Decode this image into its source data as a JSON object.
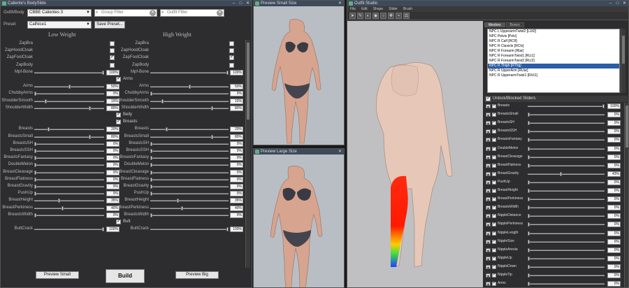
{
  "bodyslide": {
    "title": "Caliente's BodySlide",
    "outfit_label": "Outfit/Body",
    "outfit_value": "CBBE Calientes 3",
    "preset_label": "Preset",
    "preset_value": "CalNice1",
    "group_filter_placeholder": "Group Filter",
    "outfit_filter_placeholder": "Outfit Filter",
    "save_preset_label": "Save Preset...",
    "low_weight_label": "Low Weight",
    "high_weight_label": "High Weight",
    "top_rows": [
      {
        "label": "ZapBra",
        "checked": false
      },
      {
        "label": "ZapHoodCloak",
        "checked": false
      },
      {
        "label": "ZapFoolCloak",
        "checked": true
      },
      {
        "label": "ZapBody",
        "checked": false
      }
    ],
    "top_slider": {
      "label": "Mpf-Bone",
      "low": 100,
      "high": 100,
      "low_text": "100%",
      "high_text": "100%"
    },
    "arms_section": "Arms",
    "arms_rows": [
      {
        "label": "Arms",
        "low": 50,
        "high": 50,
        "low_text": "50%",
        "high_text": "50%"
      },
      {
        "label": "ChubbyArms",
        "low": 0,
        "high": 0,
        "low_text": "0%",
        "high_text": "0%"
      },
      {
        "label": "ShoulderSmooth",
        "low": 15,
        "high": 15,
        "low_text": "15%",
        "high_text": "15%"
      },
      {
        "label": "ShoulderWidth",
        "low": 80,
        "high": 80,
        "low_text": "80%",
        "high_text": "80%"
      }
    ],
    "belly_section": "Belly",
    "breasts_section": "Breasts",
    "breast_rows": [
      {
        "label": "Breasts",
        "low": 20,
        "high": 20,
        "low_text": "20%",
        "high_text": "20%"
      },
      {
        "label": "BreastsSmall",
        "low": 80,
        "high": 80,
        "low_text": "80%",
        "high_text": "80%"
      },
      {
        "label": "BreastsSH",
        "low": 0,
        "high": 0,
        "low_text": "0%",
        "high_text": "0%"
      },
      {
        "label": "BreastsSSH",
        "low": 0,
        "high": 0,
        "low_text": "0%",
        "high_text": "0%"
      },
      {
        "label": "BreastsFantasy",
        "low": 0,
        "high": 0,
        "low_text": "0%",
        "high_text": "0%"
      },
      {
        "label": "DoubleMelon",
        "low": 0,
        "high": 0,
        "low_text": "0%",
        "high_text": "0%"
      },
      {
        "label": "BreastCleavage",
        "low": 0,
        "high": 0,
        "low_text": "0%",
        "high_text": "0%"
      },
      {
        "label": "BreastFlatness",
        "low": 0,
        "high": 0,
        "low_text": "0%",
        "high_text": "0%"
      },
      {
        "label": "BreastGravity",
        "low": 0,
        "high": 0,
        "low_text": "0%",
        "high_text": "0%"
      },
      {
        "label": "PushUp",
        "low": 0,
        "high": 0,
        "low_text": "0%",
        "high_text": "0%"
      },
      {
        "label": "BreastHeight",
        "low": 35,
        "high": 35,
        "low_text": "35%",
        "high_text": "35%"
      },
      {
        "label": "BreastPerkiness",
        "low": 40,
        "high": 40,
        "low_text": "40%",
        "high_text": "40%"
      },
      {
        "label": "BreastsWidth",
        "low": 0,
        "high": 0,
        "low_text": "0%",
        "high_text": "0%"
      }
    ],
    "butt_section": "Butt",
    "butt_row": {
      "label": "ButtCrack",
      "low": 100,
      "high": 100,
      "low_text": "100%",
      "high_text": "100%"
    },
    "preview_small_label": "Preview Small",
    "build_label": "Build",
    "preview_big_label": "Preview Big"
  },
  "preview_small": {
    "title": "Preview Small Size"
  },
  "preview_large": {
    "title": "Preview Large Size"
  },
  "outfit_studio": {
    "title": "Outfit Studio",
    "menu": [
      "File",
      "Edit",
      "Shape",
      "Slider",
      "Brush"
    ],
    "tabs": [
      "Meshes",
      "Bones"
    ],
    "bone_list": [
      "NPC L UpperarmTwist2 [LUt2]",
      "NPC Pelvis [Pelv]",
      "NPC R Calf [RClf]",
      "NPC R Clavicle [RClv]",
      "NPC R Forearm [Rlar]",
      "NPC R ForearmTwist1 [RLt1]",
      "NPC R ForearmTwist2 [RLt2]",
      "NPC R Thigh [RThg]",
      "NPC R UpperArm [RUar]",
      "NPC R UpperarmTwist1 [RUt1]"
    ],
    "selected_bone_index": 7,
    "sliders_header": "Unlock/Blocked Sliders",
    "sliders": [
      {
        "name": "Breasts",
        "value": 100,
        "text": "100%"
      },
      {
        "name": "BreastsSmall",
        "value": 0,
        "text": "0%"
      },
      {
        "name": "BreastsSH",
        "value": 0,
        "text": "0%"
      },
      {
        "name": "BreastsSSH",
        "value": 0,
        "text": "0%"
      },
      {
        "name": "BreastsFantasy",
        "value": 0,
        "text": "0%"
      },
      {
        "name": "DoubleMelon",
        "value": 0,
        "text": "0%"
      },
      {
        "name": "BreastCleavage",
        "value": 0,
        "text": "0%"
      },
      {
        "name": "BreastFlatness",
        "value": 0,
        "text": "0%"
      },
      {
        "name": "BreastGravity",
        "value": 43,
        "text": "43%"
      },
      {
        "name": "PushUp",
        "value": 0,
        "text": "0%"
      },
      {
        "name": "BreastHeight",
        "value": 0,
        "text": "0%"
      },
      {
        "name": "BreastPerkiness",
        "value": 0,
        "text": "0%"
      },
      {
        "name": "BreastsWidth",
        "value": 0,
        "text": "0%"
      },
      {
        "name": "NippleDistance",
        "value": 0,
        "text": "0%"
      },
      {
        "name": "NipplePerkiness",
        "value": 0,
        "text": "0%"
      },
      {
        "name": "NippleLength",
        "value": 0,
        "text": "0%"
      },
      {
        "name": "NippleSize",
        "value": 0,
        "text": "0%"
      },
      {
        "name": "NippleAreola",
        "value": 0,
        "text": "0%"
      },
      {
        "name": "NippleUp",
        "value": 0,
        "text": "0%"
      },
      {
        "name": "NippleDown",
        "value": 0,
        "text": "0%"
      },
      {
        "name": "NippleTip",
        "value": 0,
        "text": "0%"
      },
      {
        "name": "Arms",
        "value": 0,
        "text": "0%"
      }
    ]
  }
}
